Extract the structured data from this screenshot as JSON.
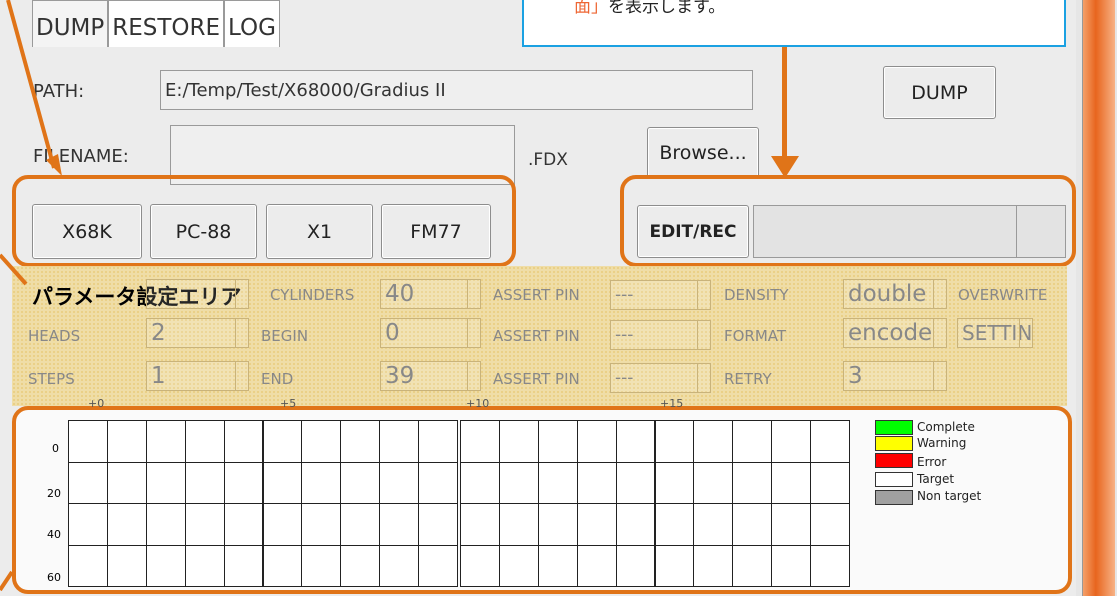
{
  "tabs": [
    "DUMP",
    "RESTORE",
    "LOG"
  ],
  "note": {
    "prefix": "面」",
    "suffix": "を表示します。"
  },
  "path": {
    "label": "PATH:",
    "value": "E:/Temp/Test/X68000/Gradius II"
  },
  "filename": {
    "label": "FILENAME:",
    "value": "",
    "ext": ".FDX"
  },
  "buttons": {
    "dump": "DUMP",
    "browse": "Browse...",
    "edit_rec": "EDIT/REC"
  },
  "machines": [
    "X68K",
    "PC-88",
    "X1",
    "FM77"
  ],
  "params": {
    "area_title": "パラメータ設定エリア",
    "cylinders_label": "CYLINDERS",
    "cylinders": "40",
    "heads_label": "HEADS",
    "heads": "2",
    "steps_label": "STEPS",
    "steps": "1",
    "begin_label": "BEGIN",
    "begin": "0",
    "end_label": "END",
    "end": "39",
    "assert_label": "ASSERT PIN",
    "assert1": "---",
    "assert2": "---",
    "assert3": "---",
    "density_label": "DENSITY",
    "density": "double",
    "format_label": "FORMAT",
    "format": "encode",
    "retry_label": "RETRY",
    "retry": "3",
    "overwrite_label": "OVERWRITE",
    "setting": "SETTIN"
  },
  "grid": {
    "col_ticks": [
      "+0",
      "+5",
      "+10",
      "+15"
    ],
    "row_ticks": [
      "0",
      "20",
      "40",
      "60"
    ]
  },
  "legend": [
    {
      "label": "Complete",
      "color": "#00ff00"
    },
    {
      "label": "Warning",
      "color": "#ffff00"
    },
    {
      "label": "Error",
      "color": "#ff0000"
    },
    {
      "label": "Target",
      "color": "#ffffff"
    },
    {
      "label": "Non target",
      "color": "#a0a0a0"
    }
  ],
  "accent_color": "#e07418"
}
